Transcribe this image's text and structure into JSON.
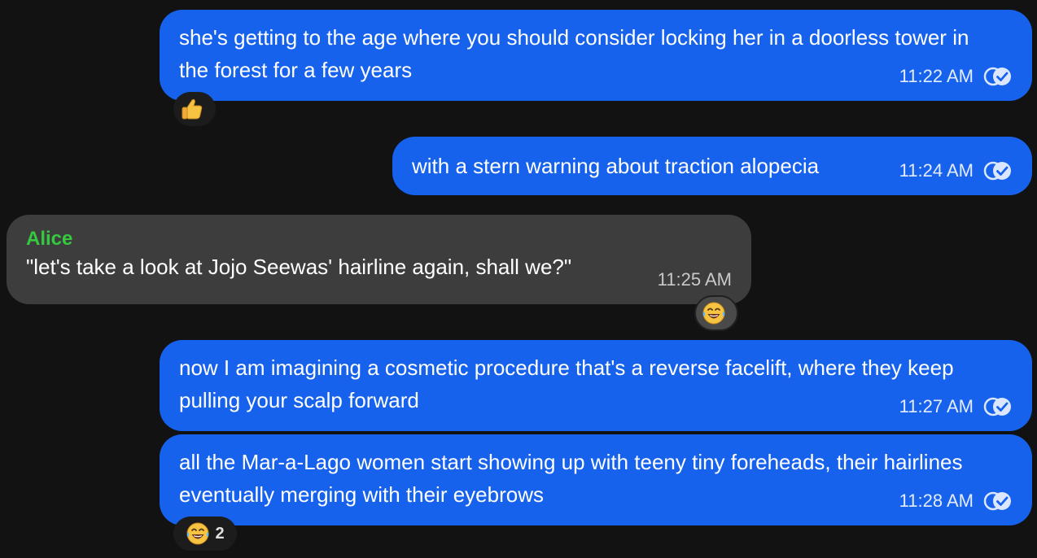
{
  "messages": [
    {
      "text": "she's getting to the age where you should consider locking her in a doorless tower in the forest for a few years",
      "time": "11:22 AM",
      "direction": "outgoing",
      "status": "read",
      "reaction": {
        "icon": "thumbs-up-emoji",
        "count": ""
      }
    },
    {
      "text": "with a stern warning about traction alopecia",
      "time": "11:24 AM",
      "direction": "outgoing",
      "status": "read"
    },
    {
      "sender": "Alice",
      "text": "\"let's take a look at Jojo Seewas' hairline again, shall we?\"",
      "time": "11:25 AM",
      "direction": "incoming",
      "reaction": {
        "icon": "tears-of-joy-emoji",
        "count": ""
      }
    },
    {
      "text": "now I am imagining a cosmetic procedure that's a reverse facelift, where they keep pulling your scalp forward",
      "time": "11:27 AM",
      "direction": "outgoing",
      "status": "read"
    },
    {
      "text": "all the Mar-a-Lago women start showing up with teeny tiny foreheads, their hairlines eventually merging with their eyebrows",
      "time": "11:28 AM",
      "direction": "outgoing",
      "status": "read",
      "reaction": {
        "icon": "tears-of-joy-emoji",
        "count": "2"
      }
    }
  ],
  "colors": {
    "background": "#121212",
    "outgoing_bubble": "#1662ec",
    "incoming_bubble": "#3d3d3d",
    "sender_name": "#35c93f"
  }
}
